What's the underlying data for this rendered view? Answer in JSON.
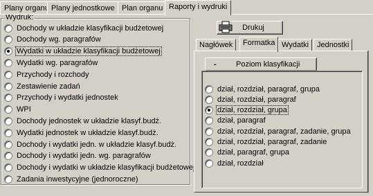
{
  "top_tabs": [
    {
      "label": "Plany organu"
    },
    {
      "label": "Plany jednostkowe"
    },
    {
      "label": "Plan organu"
    },
    {
      "label": "Raporty i wydruki",
      "active": true
    }
  ],
  "wydruk": {
    "label": "Wydruk:",
    "selected_index": 2,
    "options": [
      "Dochody w układzie klasyfikacji budżetowej",
      "Dochody wg. paragrafów",
      "Wydatki w układzie klasyfikacji budżetowej",
      "Wydatki wg. paragrafów",
      "Przychody i rozchody",
      "Zestawienie zadań",
      "Przychody i wydatki jednostek",
      "WPI",
      "Dochody jednostek w układzie klasyf.budż.",
      "Wydatki jednostek w układzie klasyf.budż.",
      "Dochody i wydatki jedn. w układzie klasyf.budż.",
      "Dochody i wydatki jedn. wg. paragrafów",
      "Dochody i wydatki w układzie klasyfikacji budżetowej",
      "Zadania inwestycyjne (jednoroczne)"
    ]
  },
  "print_button": {
    "label": "Drukuj",
    "icon": "printer-icon"
  },
  "right_tabs": [
    {
      "label": "Nagłówek"
    },
    {
      "label": "Formatka",
      "active": true
    },
    {
      "label": "Wydatki"
    },
    {
      "label": "Jednostki"
    }
  ],
  "poziom": {
    "toggle": "-",
    "label": "Poziom klasyfikacji",
    "selected_index": 2,
    "options": [
      "dział, rozdział, paragraf, grupa",
      "dział, rozdział, paragraf",
      "dział, rozdział, grupa",
      "dział, paragraf",
      "dział, rozdział, paragraf, zadanie, grupa",
      "dział, rozdział, paragraf, zadanie",
      "dział, paragraf, grupa",
      "dział, rozdział"
    ]
  }
}
